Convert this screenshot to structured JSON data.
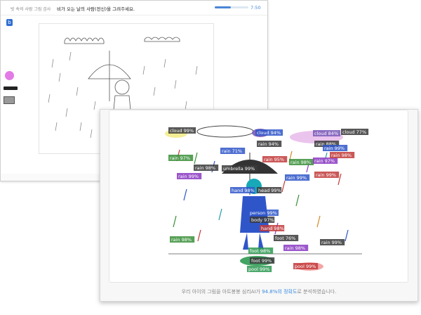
{
  "app": {
    "breadcrumb": "빗 속의 사람 그림 검사",
    "instruction": "비가 오는 날의 사람(전신)을 그려주세요.",
    "timer": "7:50",
    "progress": 0.48
  },
  "colors": {
    "accent": "#4a86d6",
    "palette_pink": "#e27be6",
    "logo": "#2f6fd1"
  },
  "tools": [
    "color-swatch-icon",
    "pen-icon",
    "eraser-icon"
  ],
  "result": {
    "caption_prefix": "우리 아이의 그림을 아트봉봉 심리AI가 ",
    "caption_accuracy": "94.8%의 정확도",
    "caption_suffix": "로 분석하였습니다.",
    "labels": [
      "cloud 99%",
      "cloud 94%",
      "cloud 84%",
      "cloud 77%",
      "umbrella 99%",
      "hand 98%",
      "head 99%",
      "person 99%",
      "body 97%",
      "hand 98%",
      "foot 76%",
      "foot 98%",
      "foot 99%",
      "pool 99%",
      "pool 99%",
      "rain 94%",
      "rain 71%",
      "rain 95%",
      "rain 98%",
      "rain 97%",
      "rain 88%",
      "rain 99%",
      "rain 98%",
      "rain 97%",
      "rain 99%",
      "rain 98%",
      "rain 99%",
      "rain 99%",
      "rain 98%",
      "rain 98%",
      "rain 99%"
    ]
  }
}
